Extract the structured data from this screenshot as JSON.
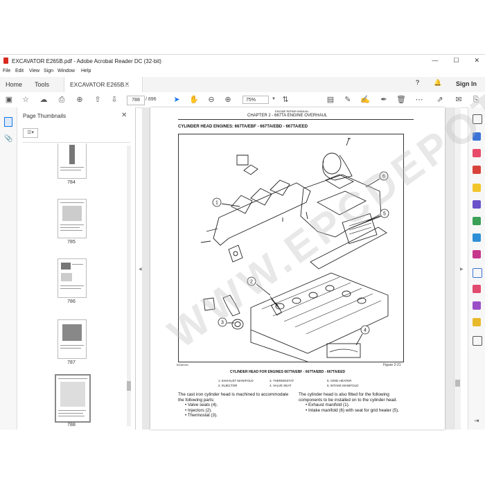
{
  "window": {
    "title": "EXCAVATOR E265B.pdf - Adobe Acrobat Reader DC (32-bit)",
    "controls": [
      "—",
      "☐",
      "✕"
    ]
  },
  "menu": [
    "File",
    "Edit",
    "View",
    "Sign",
    "Window",
    "Help"
  ],
  "tabs": {
    "home": "Home",
    "tools": "Tools",
    "document": "EXCAVATOR E265B...",
    "close": "✕",
    "signin": "Sign In"
  },
  "toolbar": {
    "page_current": "788",
    "page_total": "/ 896",
    "zoom": "75%"
  },
  "thumbnails": {
    "header": "Page Thumbnails",
    "close": "✕",
    "pages": [
      "784",
      "785",
      "786",
      "787",
      "788"
    ]
  },
  "document": {
    "header_small": "ENGINE REPAIR MANUAL",
    "chapter": "CHAPTER 2 - 667TA ENGINE OVERHAUL",
    "section_title": "CYLINDER HEAD ENGINES: 667TA/EBF - 667TA/EBD - 667TA/EED",
    "figure_id": "BS06K000",
    "figure_ref": "Figure 2-21",
    "figure_caption": "CYLINDER HEAD FOR ENGINES 667TA/EBF - 667TA/EBD - 667TA/EED",
    "callouts": [
      "1",
      "2",
      "3",
      "4",
      "5",
      "6"
    ],
    "legend": [
      [
        "1. EXHAUST MANIFOLD",
        "3. THERMOSTAT",
        "5. GRID HEATER"
      ],
      [
        "2. INJECTOR",
        "4. VALVE SEAT",
        "6. INTAKE MANIFOLD"
      ]
    ],
    "left_para": {
      "text": "The cast iron cylinder head is machined to accommodate the following parts:",
      "bullets": [
        "Valve seats (4).",
        "Injectors (2).",
        "Thermostat (3)."
      ]
    },
    "right_para": {
      "text": "The cylinder head is also fitted for the following components to be installed on to the cylinder head.",
      "bullets": [
        "Exhaust manifold (1).",
        "Intake manifold (6) with seat for grid heater (5)."
      ]
    }
  },
  "watermark": "WWW.EPCDEPOT.COM"
}
